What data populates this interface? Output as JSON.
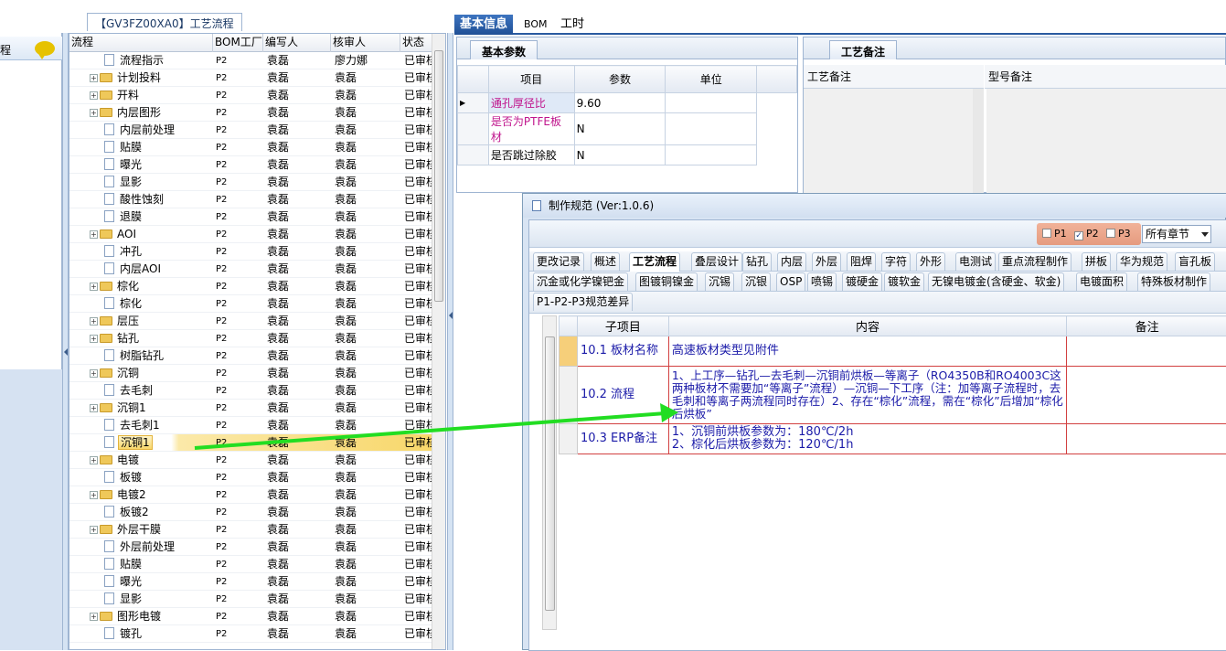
{
  "left_panel": {
    "label": "程"
  },
  "tree": {
    "title": "【GV3FZ00XA0】工艺流程",
    "columns": [
      "流程",
      "BOM工厂",
      "编写人",
      "核审人",
      "状态"
    ],
    "rows": [
      {
        "name": "流程指示",
        "level": 2,
        "kind": "file",
        "bom": "P2",
        "writer": "袁磊",
        "reviewer": "廖力娜",
        "status": "已审核"
      },
      {
        "name": "计划投料",
        "level": 1,
        "kind": "folder",
        "bom": "P2",
        "writer": "袁磊",
        "reviewer": "袁磊",
        "status": "已审核"
      },
      {
        "name": "开料",
        "level": 1,
        "kind": "folder",
        "bom": "P2",
        "writer": "袁磊",
        "reviewer": "袁磊",
        "status": "已审核"
      },
      {
        "name": "内层图形",
        "level": 1,
        "kind": "folder",
        "bom": "P2",
        "writer": "袁磊",
        "reviewer": "袁磊",
        "status": "已审核"
      },
      {
        "name": "内层前处理",
        "level": 2,
        "kind": "file",
        "bom": "P2",
        "writer": "袁磊",
        "reviewer": "袁磊",
        "status": "已审核"
      },
      {
        "name": "贴膜",
        "level": 2,
        "kind": "file",
        "bom": "P2",
        "writer": "袁磊",
        "reviewer": "袁磊",
        "status": "已审核"
      },
      {
        "name": "曝光",
        "level": 2,
        "kind": "file",
        "bom": "P2",
        "writer": "袁磊",
        "reviewer": "袁磊",
        "status": "已审核"
      },
      {
        "name": "显影",
        "level": 2,
        "kind": "file",
        "bom": "P2",
        "writer": "袁磊",
        "reviewer": "袁磊",
        "status": "已审核"
      },
      {
        "name": "酸性蚀刻",
        "level": 2,
        "kind": "file",
        "bom": "P2",
        "writer": "袁磊",
        "reviewer": "袁磊",
        "status": "已审核"
      },
      {
        "name": "退膜",
        "level": 2,
        "kind": "file",
        "bom": "P2",
        "writer": "袁磊",
        "reviewer": "袁磊",
        "status": "已审核"
      },
      {
        "name": "AOI",
        "level": 1,
        "kind": "folder",
        "bom": "P2",
        "writer": "袁磊",
        "reviewer": "袁磊",
        "status": "已审核"
      },
      {
        "name": "冲孔",
        "level": 2,
        "kind": "file",
        "bom": "P2",
        "writer": "袁磊",
        "reviewer": "袁磊",
        "status": "已审核"
      },
      {
        "name": "内层AOI",
        "level": 2,
        "kind": "file",
        "bom": "P2",
        "writer": "袁磊",
        "reviewer": "袁磊",
        "status": "已审核"
      },
      {
        "name": "棕化",
        "level": 1,
        "kind": "folder",
        "bom": "P2",
        "writer": "袁磊",
        "reviewer": "袁磊",
        "status": "已审核"
      },
      {
        "name": "棕化",
        "level": 2,
        "kind": "file",
        "bom": "P2",
        "writer": "袁磊",
        "reviewer": "袁磊",
        "status": "已审核"
      },
      {
        "name": "层压",
        "level": 1,
        "kind": "folder",
        "bom": "P2",
        "writer": "袁磊",
        "reviewer": "袁磊",
        "status": "已审核"
      },
      {
        "name": "钻孔",
        "level": 1,
        "kind": "folder",
        "bom": "P2",
        "writer": "袁磊",
        "reviewer": "袁磊",
        "status": "已审核"
      },
      {
        "name": "树脂钻孔",
        "level": 2,
        "kind": "file",
        "bom": "P2",
        "writer": "袁磊",
        "reviewer": "袁磊",
        "status": "已审核"
      },
      {
        "name": "沉铜",
        "level": 1,
        "kind": "folder",
        "bom": "P2",
        "writer": "袁磊",
        "reviewer": "袁磊",
        "status": "已审核"
      },
      {
        "name": "去毛刺",
        "level": 2,
        "kind": "file",
        "bom": "P2",
        "writer": "袁磊",
        "reviewer": "袁磊",
        "status": "已审核"
      },
      {
        "name": "沉铜1",
        "level": 1,
        "kind": "folder",
        "bom": "P2",
        "writer": "袁磊",
        "reviewer": "袁磊",
        "status": "已审核"
      },
      {
        "name": "去毛刺1",
        "level": 2,
        "kind": "file",
        "bom": "P2",
        "writer": "袁磊",
        "reviewer": "袁磊",
        "status": "已审核"
      },
      {
        "name": "沉铜1",
        "level": 2,
        "kind": "file",
        "bom": "P2",
        "writer": "袁磊",
        "reviewer": "袁磊",
        "status": "已审核",
        "selected": true
      },
      {
        "name": "电镀",
        "level": 1,
        "kind": "folder",
        "bom": "P2",
        "writer": "袁磊",
        "reviewer": "袁磊",
        "status": "已审核"
      },
      {
        "name": "板镀",
        "level": 2,
        "kind": "file",
        "bom": "P2",
        "writer": "袁磊",
        "reviewer": "袁磊",
        "status": "已审核"
      },
      {
        "name": "电镀2",
        "level": 1,
        "kind": "folder",
        "bom": "P2",
        "writer": "袁磊",
        "reviewer": "袁磊",
        "status": "已审核"
      },
      {
        "name": "板镀2",
        "level": 2,
        "kind": "file",
        "bom": "P2",
        "writer": "袁磊",
        "reviewer": "袁磊",
        "status": "已审核"
      },
      {
        "name": "外层干膜",
        "level": 1,
        "kind": "folder",
        "bom": "P2",
        "writer": "袁磊",
        "reviewer": "袁磊",
        "status": "已审核"
      },
      {
        "name": "外层前处理",
        "level": 2,
        "kind": "file",
        "bom": "P2",
        "writer": "袁磊",
        "reviewer": "袁磊",
        "status": "已审核"
      },
      {
        "name": "贴膜",
        "level": 2,
        "kind": "file",
        "bom": "P2",
        "writer": "袁磊",
        "reviewer": "袁磊",
        "status": "已审核"
      },
      {
        "name": "曝光",
        "level": 2,
        "kind": "file",
        "bom": "P2",
        "writer": "袁磊",
        "reviewer": "袁磊",
        "status": "已审核"
      },
      {
        "name": "显影",
        "level": 2,
        "kind": "file",
        "bom": "P2",
        "writer": "袁磊",
        "reviewer": "袁磊",
        "status": "已审核"
      },
      {
        "name": "图形电镀",
        "level": 1,
        "kind": "folder",
        "bom": "P2",
        "writer": "袁磊",
        "reviewer": "袁磊",
        "status": "已审核"
      },
      {
        "name": "镀孔",
        "level": 2,
        "kind": "file",
        "bom": "P2",
        "writer": "袁磊",
        "reviewer": "袁磊",
        "status": "已审核"
      }
    ]
  },
  "main_tabs": [
    "基本信息",
    "BOM",
    "工时"
  ],
  "basic": {
    "tab": "基本参数",
    "headers": [
      "项目",
      "参数",
      "单位"
    ],
    "rows": [
      {
        "item": "通孔厚径比",
        "value": "9.60",
        "unit": ""
      },
      {
        "item": "是否为PTFE板材",
        "value": "N",
        "unit": ""
      },
      {
        "item": "是否跳过除胶",
        "value": "N",
        "unit": ""
      }
    ]
  },
  "notes": {
    "tab": "工艺备注",
    "col1": "工艺备注",
    "col2": "型号备注"
  },
  "dialog": {
    "title": "制作规范 (Ver:1.0.6)",
    "checks": [
      {
        "label": "P1",
        "checked": false
      },
      {
        "label": "P2",
        "checked": true
      },
      {
        "label": "P3",
        "checked": false
      }
    ],
    "dropdown": "所有章节",
    "tabs_row1": [
      "更改记录",
      "概述",
      "工艺流程",
      "叠层设计",
      "钻孔",
      "内层",
      "外层",
      "阻焊",
      "字符",
      "外形",
      "电测试",
      "重点流程制作",
      "拼板",
      "华为规范",
      "盲孔板"
    ],
    "tabs_row2": [
      "沉金或化学镍钯金",
      "图镀铜镍金",
      "沉锡",
      "沉银",
      "OSP",
      "喷锡",
      "镀硬金",
      "镀软金",
      "无镍电镀金(含硬金、软金)",
      "电镀面积",
      "特殊板材制作"
    ],
    "tabs_row3": [
      "P1-P2-P3规范差异"
    ],
    "grid_headers": [
      "子项目",
      "内容",
      "备注"
    ],
    "grid_rows": [
      {
        "sub": "10.1 板材名称",
        "content": "高速板材类型见附件",
        "note": ""
      },
      {
        "sub": "10.2 流程",
        "content": "1、上工序—钻孔—去毛刺—沉铜前烘板—等离子（RO4350B和RO4003C这两种板材不需要加“等离子”流程）—沉铜—下工序（注：加等离子流程时，去毛刺和等离子两流程同时存在）2、存在“棕化”流程，需在“棕化”后增加“棕化后烘板”",
        "note": ""
      },
      {
        "sub": "10.3 ERP备注",
        "content": "1、沉铜前烘板参数为：180℃/2h\n2、棕化后烘板参数为：120℃/1h",
        "note": ""
      }
    ]
  },
  "colors": {
    "accent": "#1f4f95",
    "arrow": "#22dd22",
    "red_border": "#d24040",
    "magenta_text": "#c0148c"
  }
}
